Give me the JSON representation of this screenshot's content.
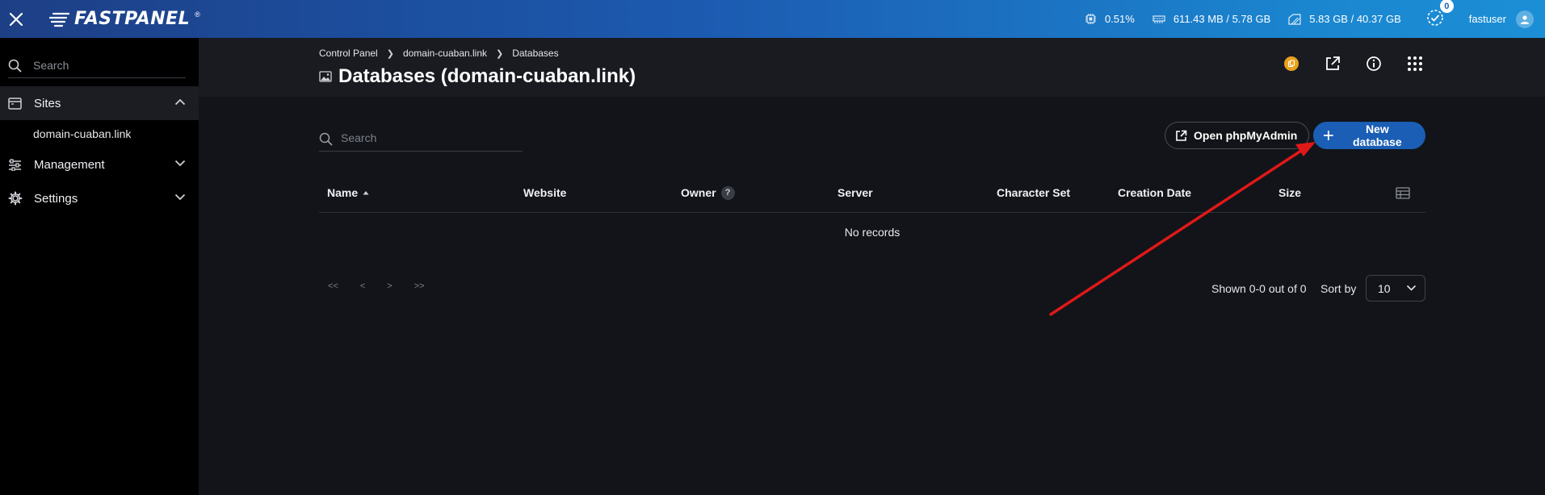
{
  "topbar": {
    "logo_text": "FASTPANEL",
    "logo_reg": "®",
    "cpu": "0.51%",
    "memory": "611.43 MB / 5.78 GB",
    "disk": "5.83 GB / 40.37 GB",
    "notifications": "0",
    "username": "fastuser"
  },
  "sidebar": {
    "search_placeholder": "Search",
    "items": [
      {
        "label": "Sites",
        "icon": "browser-window-icon",
        "expanded": true,
        "children": [
          "domain-cuaban.link"
        ]
      },
      {
        "label": "Management",
        "icon": "sliders-icon",
        "expanded": false
      },
      {
        "label": "Settings",
        "icon": "gear-icon",
        "expanded": false
      }
    ]
  },
  "header": {
    "breadcrumb": [
      "Control Panel",
      "domain-cuaban.link",
      "Databases"
    ],
    "title": "Databases (domain-cuaban.link)"
  },
  "table": {
    "search_placeholder": "Search",
    "open_pma_label": "Open phpMyAdmin",
    "new_db_label": "New database",
    "columns": [
      "Name",
      "Website",
      "Owner",
      "Server",
      "Character Set",
      "Creation Date",
      "Size"
    ],
    "owner_help": "?",
    "empty_text": "No records",
    "pager": [
      "<<",
      "<",
      ">",
      ">>"
    ],
    "shown_text": "Shown 0-0 out of 0",
    "sort_label": "Sort by",
    "page_size": "10"
  },
  "colors": {
    "accent": "#1b5eb5",
    "annotation_arrow": "#e01818",
    "coin": "#e8a21e"
  }
}
